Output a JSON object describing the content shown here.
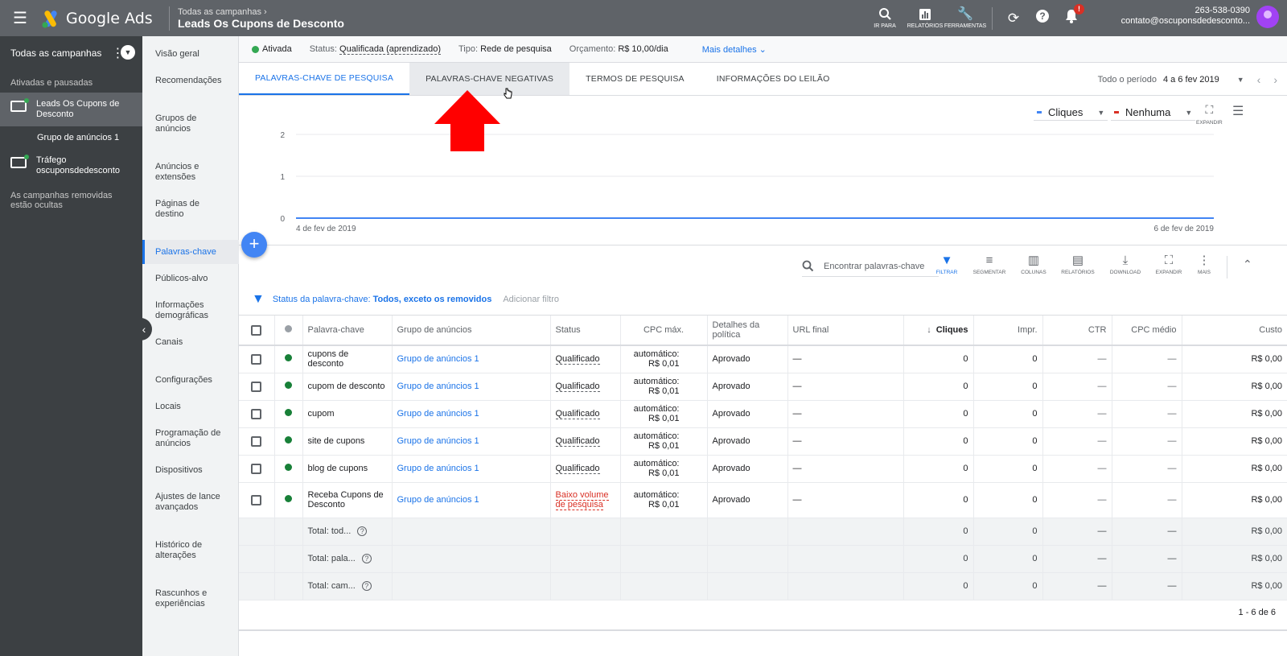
{
  "topbar": {
    "app_name": "Google Ads",
    "breadcrumb_parent": "Todas as campanhas",
    "breadcrumb_current": "Leads Os Cupons de Desconto",
    "tools": [
      {
        "label": "IR PARA",
        "icon": "search-icon"
      },
      {
        "label": "RELATÓRIOS",
        "icon": "reports-icon"
      },
      {
        "label": "FERRAMENTAS",
        "icon": "wrench-icon"
      }
    ],
    "notification_badge": "!",
    "account_id": "263-538-0390",
    "account_email": "contato@oscuponsdedesconto..."
  },
  "leftnav": {
    "title": "Todas as campanhas",
    "subtitle": "Ativadas e pausadas",
    "campaigns": [
      {
        "name": "Leads Os Cupons de Desconto"
      },
      {
        "name": "Tráfego oscuponsdedesconto"
      }
    ],
    "group": "Grupo de anúncios 1",
    "note": "As campanhas removidas estão ocultas"
  },
  "pagenav": {
    "items": [
      "Visão geral",
      "Recomendações",
      "Grupos de anúncios",
      "Anúncios e extensões",
      "Páginas de destino",
      "Palavras-chave",
      "Públicos-alvo",
      "Informações demográficas",
      "Canais",
      "Configurações",
      "Locais",
      "Programação de anúncios",
      "Dispositivos",
      "Ajustes de lance avançados",
      "Histórico de alterações",
      "Rascunhos e experiências"
    ]
  },
  "statusbar": {
    "state": "Ativada",
    "status_label": "Status:",
    "status_value": "Qualificada (aprendizado)",
    "type_label": "Tipo:",
    "type_value": "Rede de pesquisa",
    "budget_label": "Orçamento:",
    "budget_value": "R$ 10,00/dia",
    "more": "Mais detalhes"
  },
  "tabs": [
    "PALAVRAS-CHAVE DE PESQUISA",
    "PALAVRAS-CHAVE NEGATIVAS",
    "TERMOS DE PESQUISA",
    "INFORMAÇÕES DO LEILÃO"
  ],
  "period": {
    "label": "Todo o período",
    "value": "4 a 6 fev 2019"
  },
  "chart": {
    "metric1": "Cliques",
    "metric2": "Nenhuma",
    "expand": "EXPANDIR",
    "metric1_color": "#4285f4",
    "metric2_color": "#d93025"
  },
  "chart_data": {
    "type": "line",
    "x": [
      "4 de fev de 2019",
      "6 de fev de 2019"
    ],
    "series": [
      {
        "name": "Cliques",
        "values": [
          0,
          0
        ]
      }
    ],
    "yticks": [
      0,
      1,
      2
    ],
    "ylim": [
      0,
      2
    ]
  },
  "toolbar": {
    "search_placeholder": "Encontrar palavras-chave",
    "tools": [
      "FILTRAR",
      "SEGMENTAR",
      "COLUNAS",
      "RELATÓRIOS",
      "DOWNLOAD",
      "EXPANDIR",
      "MAIS"
    ]
  },
  "filter": {
    "label": "Status da palavra-chave:",
    "value": "Todos, exceto os removidos",
    "add": "Adicionar filtro"
  },
  "table": {
    "headers": [
      "Palavra-chave",
      "Grupo de anúncios",
      "Status",
      "CPC máx.",
      "Detalhes da política",
      "URL final",
      "Cliques",
      "Impr.",
      "CTR",
      "CPC médio",
      "Custo"
    ],
    "rows": [
      {
        "keyword": "cupons de desconto",
        "group": "Grupo de anúncios 1",
        "status": "Qualificado",
        "cpc1": "automático:",
        "cpc2": "R$ 0,01",
        "policy": "Aprovado",
        "url": "—",
        "clicks": "0",
        "impr": "0",
        "ctr": "—",
        "avg": "—",
        "cost": "R$ 0,00"
      },
      {
        "keyword": "cupom de desconto",
        "group": "Grupo de anúncios 1",
        "status": "Qualificado",
        "cpc1": "automático:",
        "cpc2": "R$ 0,01",
        "policy": "Aprovado",
        "url": "—",
        "clicks": "0",
        "impr": "0",
        "ctr": "—",
        "avg": "—",
        "cost": "R$ 0,00"
      },
      {
        "keyword": "cupom",
        "group": "Grupo de anúncios 1",
        "status": "Qualificado",
        "cpc1": "automático:",
        "cpc2": "R$ 0,01",
        "policy": "Aprovado",
        "url": "—",
        "clicks": "0",
        "impr": "0",
        "ctr": "—",
        "avg": "—",
        "cost": "R$ 0,00"
      },
      {
        "keyword": "site de cupons",
        "group": "Grupo de anúncios 1",
        "status": "Qualificado",
        "cpc1": "automático:",
        "cpc2": "R$ 0,01",
        "policy": "Aprovado",
        "url": "—",
        "clicks": "0",
        "impr": "0",
        "ctr": "—",
        "avg": "—",
        "cost": "R$ 0,00"
      },
      {
        "keyword": "blog de cupons",
        "group": "Grupo de anúncios 1",
        "status": "Qualificado",
        "cpc1": "automático:",
        "cpc2": "R$ 0,01",
        "policy": "Aprovado",
        "url": "—",
        "clicks": "0",
        "impr": "0",
        "ctr": "—",
        "avg": "—",
        "cost": "R$ 0,00"
      },
      {
        "keyword": "Receba Cupons de Desconto",
        "group": "Grupo de anúncios 1",
        "status": "Baixo volume de pesquisa",
        "cpc1": "automático:",
        "cpc2": "R$ 0,01",
        "policy": "Aprovado",
        "url": "—",
        "clicks": "0",
        "impr": "0",
        "ctr": "—",
        "avg": "—",
        "cost": "R$ 0,00"
      }
    ],
    "totals": [
      {
        "label": "Total: tod...",
        "clicks": "0",
        "impr": "0",
        "ctr": "—",
        "avg": "—",
        "cost": "R$ 0,00"
      },
      {
        "label": "Total: pala...",
        "clicks": "0",
        "impr": "0",
        "ctr": "—",
        "avg": "—",
        "cost": "R$ 0,00"
      },
      {
        "label": "Total: cam...",
        "clicks": "0",
        "impr": "0",
        "ctr": "—",
        "avg": "—",
        "cost": "R$ 0,00"
      }
    ],
    "pager": "1 - 6 de 6"
  }
}
